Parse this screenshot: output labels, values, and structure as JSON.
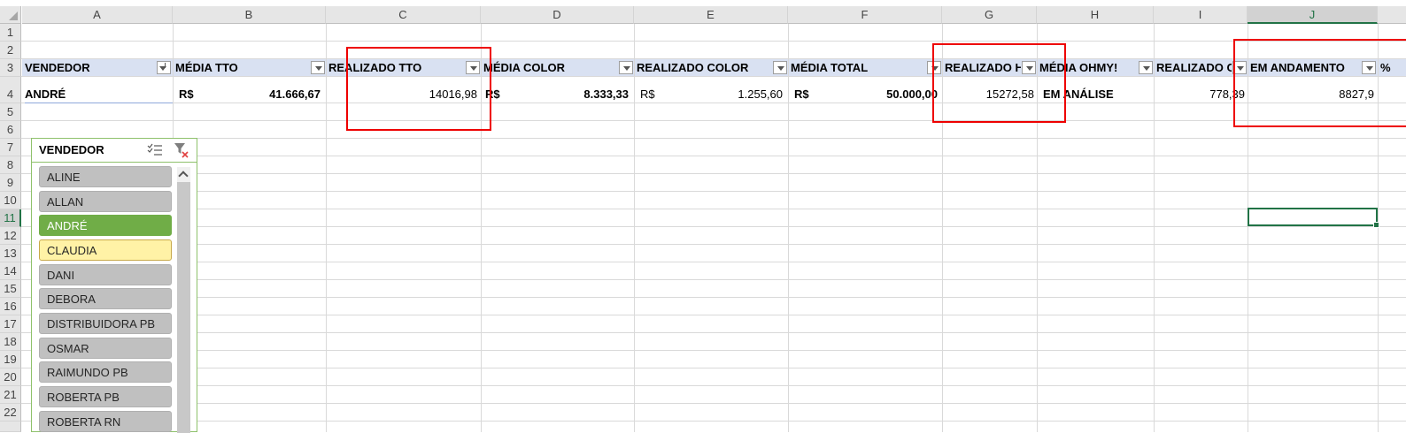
{
  "columns": [
    "A",
    "B",
    "C",
    "D",
    "E",
    "F",
    "G",
    "H",
    "I",
    "J"
  ],
  "rows": [
    "1",
    "2",
    "3",
    "4",
    "5",
    "6",
    "7",
    "8",
    "9",
    "10",
    "11",
    "12",
    "13",
    "14",
    "15",
    "16",
    "17",
    "18",
    "19",
    "20",
    "21",
    "22"
  ],
  "headers": {
    "a": "VENDEDOR",
    "b": "MÉDIA TTO",
    "c": "REALIZADO TTO",
    "d": "MÉDIA COLOR",
    "e": "REALIZADO COLOR",
    "f": "MÉDIA TOTAL",
    "g": "REALIZADO HA",
    "h": "MÉDIA OHMY!",
    "i": "REALIZADO OH",
    "j": "EM ANDAMENTO",
    "k": "%"
  },
  "row4": {
    "vendedor": "ANDRÉ",
    "currency": "R$",
    "media_tto": "41.666,67",
    "realizado_tto": "14016,98",
    "media_color": "8.333,33",
    "realizado_color": "1.255,60",
    "media_total": "50.000,00",
    "realizado_ha": "15272,58",
    "media_ohmy": "EM ANÁLISE",
    "realizado_oh": "778,39",
    "em_andamento": "8827,9"
  },
  "slicer": {
    "title": "VENDEDOR",
    "selected": "ANDRÉ",
    "items": [
      "ALINE",
      "ALLAN",
      "ANDRÉ",
      "CLAUDIA",
      "DANI",
      "DEBORA",
      "DISTRIBUIDORA PB",
      "OSMAR",
      "RAIMUNDO PB",
      "ROBERTA PB",
      "ROBERTA RN"
    ]
  },
  "colors": {
    "header_band": "#d9e1f2",
    "slicer_selected": "#70ad47",
    "highlight_box": "#ee0000",
    "selection": "#217346"
  }
}
